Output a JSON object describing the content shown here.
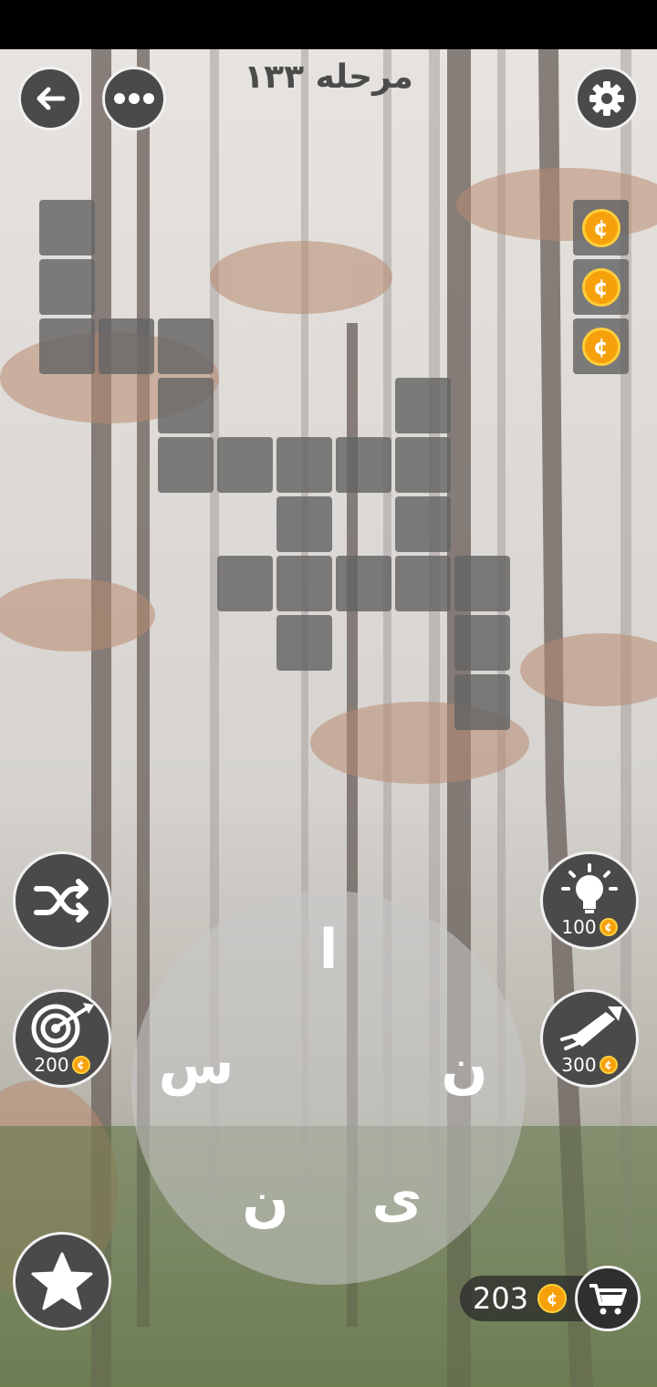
{
  "header": {
    "level_title": "مرحله ۱۳۳"
  },
  "icons": {
    "back": "back-arrow-icon",
    "more": "more-dots-icon",
    "settings": "gear-icon",
    "shuffle": "shuffle-icon",
    "hint": "lightbulb-icon",
    "target": "target-dart-icon",
    "rocket": "rocket-icon",
    "star": "star-icon",
    "cart": "cart-icon",
    "coin": "coin-icon"
  },
  "coin_symbol": "¢",
  "powerups": {
    "hint_cost": "100",
    "target_cost": "200",
    "rocket_cost": "300"
  },
  "wheel": {
    "letters": [
      "ا",
      "ن",
      "ی",
      "ن",
      "س"
    ]
  },
  "wallet": {
    "coins": "203"
  },
  "colors": {
    "tile": "#646464",
    "coin": "#f6a10c",
    "button": "#4a4a4a"
  }
}
